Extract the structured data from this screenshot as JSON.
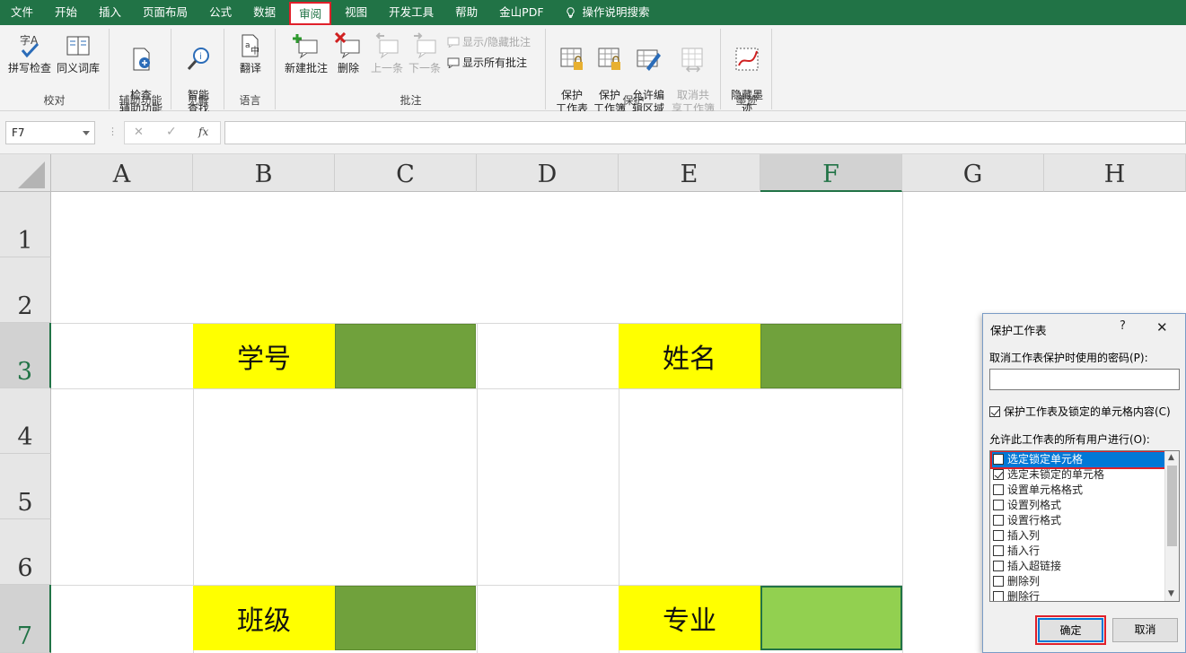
{
  "menu": {
    "items": [
      "文件",
      "开始",
      "插入",
      "页面布局",
      "公式",
      "数据",
      "审阅",
      "视图",
      "开发工具",
      "帮助",
      "金山PDF",
      "操作说明搜索"
    ],
    "active_index": 6
  },
  "ribbon": {
    "groups": {
      "proofing": {
        "label": "校对",
        "spell": "拼写检查",
        "thesaurus": "同义词库"
      },
      "accessibility": {
        "label": "辅助功能",
        "check": "检查\n辅助功能"
      },
      "insights": {
        "label": "见解",
        "smart": "智能\n查找"
      },
      "language": {
        "label": "语言",
        "translate": "翻译"
      },
      "comments": {
        "label": "批注",
        "new": "新建批注",
        "delete": "删除",
        "prev": "上一条",
        "next": "下一条",
        "show_hide": "显示/隐藏批注",
        "show_all": "显示所有批注"
      },
      "protect": {
        "label": "保护",
        "sheet": "保护\n工作表",
        "workbook": "保护\n工作簿",
        "allow_edit": "允许编\n辑区域",
        "unshare": "取消共\n享工作簿"
      },
      "ink": {
        "label": "墨迹",
        "hide": "隐藏墨\n迹"
      }
    }
  },
  "formula_bar": {
    "name_box": "F7",
    "fx": "fx",
    "cancel": "✕",
    "enter": "✓",
    "content": ""
  },
  "sheet": {
    "columns": [
      "A",
      "B",
      "C",
      "D",
      "E",
      "F",
      "G",
      "H"
    ],
    "rows": [
      "1",
      "2",
      "3",
      "4",
      "5",
      "6",
      "7"
    ],
    "selected_column": "F",
    "selected_row": "7",
    "cells": {
      "B3": "学号",
      "E3": "姓名",
      "B7": "班级",
      "E7": "专业"
    }
  },
  "dialog": {
    "title": "保护工作表",
    "help": "?",
    "close": "✕",
    "password_label": "取消工作表保护时使用的密码(P):",
    "protect_checkbox": "保护工作表及锁定的单元格内容(C)",
    "protect_checked": true,
    "allow_label": "允许此工作表的所有用户进行(O):",
    "permissions": [
      {
        "label": "选定锁定单元格",
        "checked": false
      },
      {
        "label": "选定未锁定的单元格",
        "checked": true
      },
      {
        "label": "设置单元格格式",
        "checked": false
      },
      {
        "label": "设置列格式",
        "checked": false
      },
      {
        "label": "设置行格式",
        "checked": false
      },
      {
        "label": "插入列",
        "checked": false
      },
      {
        "label": "插入行",
        "checked": false
      },
      {
        "label": "插入超链接",
        "checked": false
      },
      {
        "label": "删除列",
        "checked": false
      },
      {
        "label": "删除行",
        "checked": false
      }
    ],
    "ok": "确定",
    "cancel": "取消"
  },
  "colors": {
    "brand": "#217346",
    "yellow": "#ffff00",
    "green_dark": "#70a13c",
    "green_light": "#92d050",
    "highlight": "#e0202a",
    "selection": "#0078d7"
  }
}
